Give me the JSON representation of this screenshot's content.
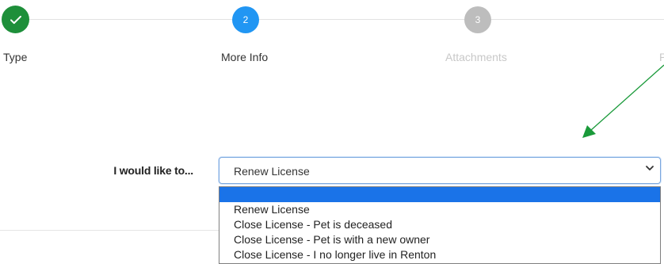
{
  "stepper": {
    "steps": [
      {
        "label": "Type",
        "state": "done"
      },
      {
        "label": "More Info",
        "number": "2",
        "state": "active"
      },
      {
        "label": "Attachments",
        "number": "3",
        "state": "pending"
      },
      {
        "label": "P",
        "state": "pending"
      }
    ]
  },
  "form": {
    "label": "I would like to...",
    "select_value": "Renew License"
  },
  "dropdown": {
    "options": [
      "",
      "Renew License",
      "Close License - Pet is deceased",
      "Close License - Pet is with a new owner",
      "Close License - I no longer live in Renton"
    ]
  },
  "colors": {
    "done": "#1e8f3a",
    "active": "#2196f3",
    "pending": "#bdbdbd",
    "highlight": "#1a73e8",
    "arrow": "#1a9a3a"
  }
}
